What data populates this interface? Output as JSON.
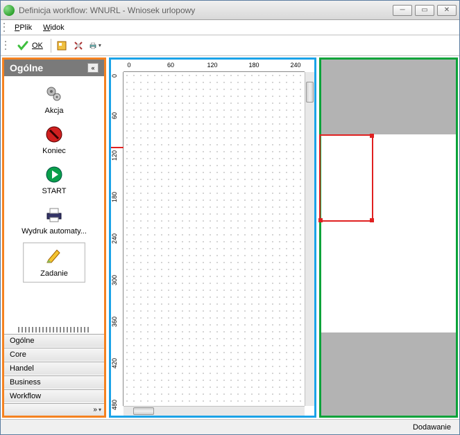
{
  "window": {
    "title": "Definicja workflow: WNURL - Wniosek urlopowy"
  },
  "menu": {
    "file": "Plik",
    "view": "Widok"
  },
  "toolbar": {
    "ok_label": "OK"
  },
  "sidebar": {
    "header": "Ogólne",
    "items": [
      {
        "label": "Akcja"
      },
      {
        "label": "Koniec"
      },
      {
        "label": "START"
      },
      {
        "label": "Wydruk automaty..."
      },
      {
        "label": "Zadanie"
      }
    ],
    "categories": [
      "Ogólne",
      "Core",
      "Handel",
      "Business",
      "Workflow"
    ]
  },
  "ruler": {
    "h": [
      "0",
      "60",
      "120",
      "180",
      "240"
    ],
    "v": [
      "0",
      "60",
      "120",
      "180",
      "240",
      "300",
      "360",
      "420",
      "480"
    ]
  },
  "status": {
    "text": "Dodawanie"
  }
}
